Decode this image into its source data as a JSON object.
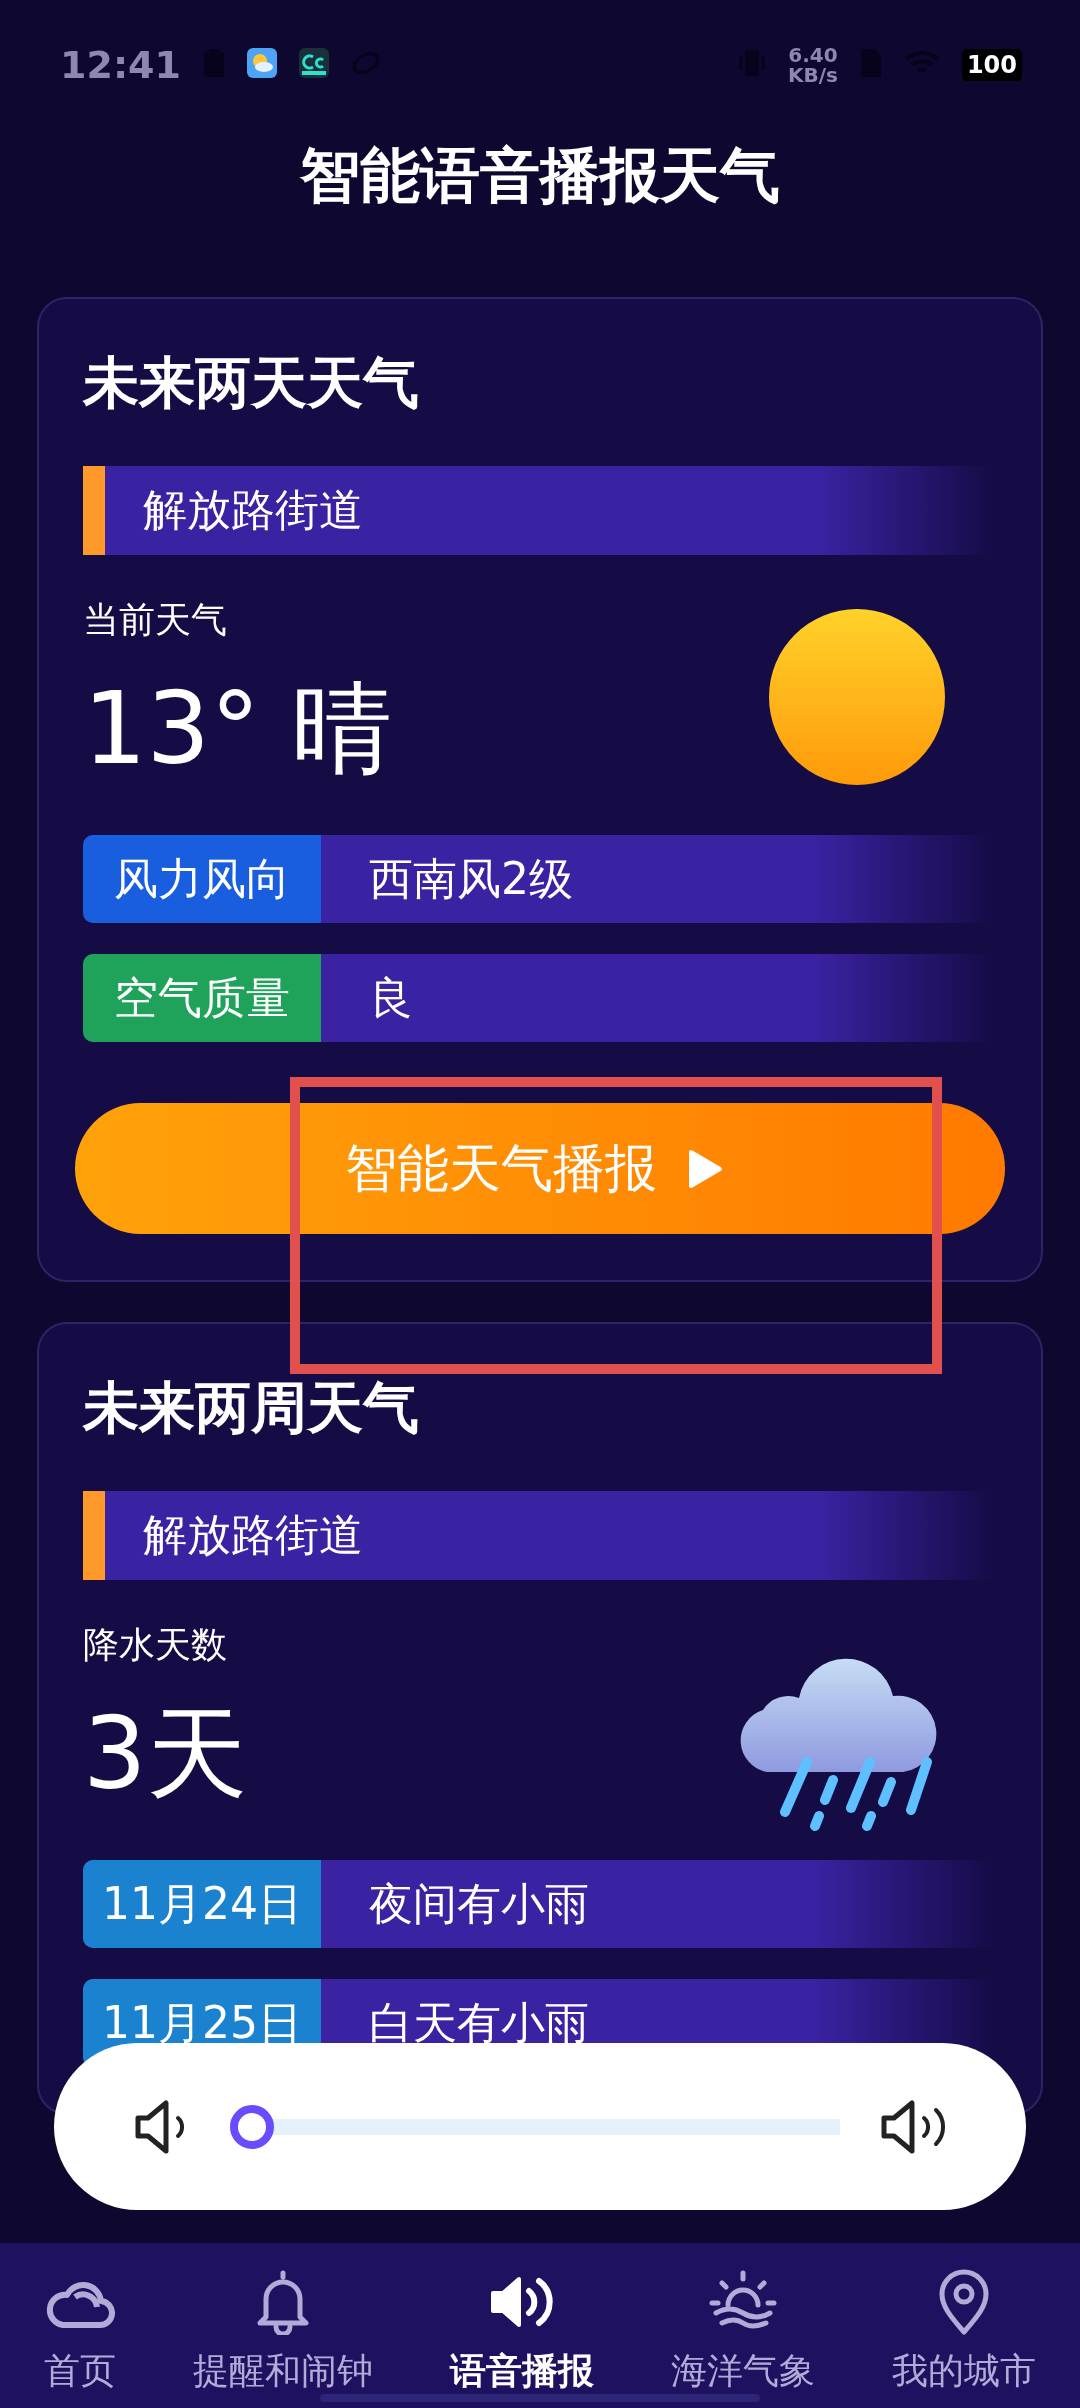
{
  "status_bar": {
    "time": "12:41",
    "speed_value": "6.40",
    "speed_unit": "KB/s",
    "battery": "100"
  },
  "title": "智能语音播报天气",
  "cards": [
    {
      "title": "未来两天天气",
      "location": "解放路街道",
      "metric_label": "当前天气",
      "metric_value": "13° 晴",
      "rows": [
        {
          "label": "风力风向",
          "value": "西南风2级",
          "color": "#1a5ee0"
        },
        {
          "label": "空气质量",
          "value": "良",
          "color": "#1fa35a"
        }
      ],
      "button": "智能天气播报"
    },
    {
      "title": "未来两周天气",
      "location": "解放路街道",
      "metric_label": "降水天数",
      "metric_value": "3天",
      "rows": [
        {
          "label": "11月24日",
          "value": "夜间有小雨",
          "color": "#1b82cf"
        },
        {
          "label": "11月25日",
          "value": "白天有小雨",
          "color": "#1b82cf"
        }
      ]
    }
  ],
  "volume": {
    "level": 0
  },
  "tabs": [
    {
      "label": "首页",
      "selected": false
    },
    {
      "label": "提醒和闹钟",
      "selected": false
    },
    {
      "label": "语音播报",
      "selected": true
    },
    {
      "label": "海洋气象",
      "selected": false
    },
    {
      "label": "我的城市",
      "selected": false
    }
  ]
}
